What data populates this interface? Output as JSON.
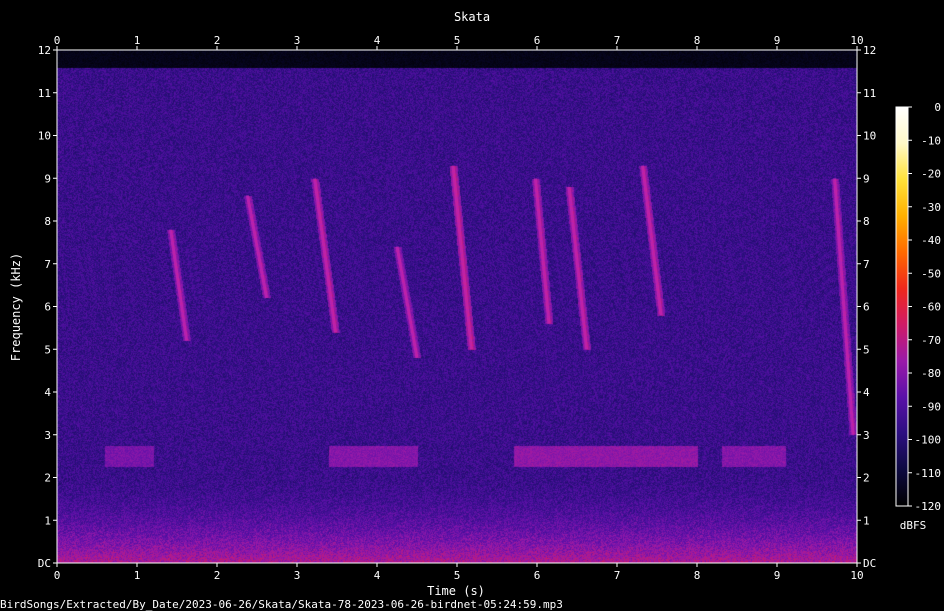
{
  "chart_data": {
    "type": "heatmap",
    "title": "Skata",
    "xlabel": "Time (s)",
    "ylabel": "Frequency (kHz)",
    "xlim": [
      0,
      10
    ],
    "ylim": [
      0,
      12
    ],
    "x_ticks": [
      "0",
      "1",
      "2",
      "3",
      "4",
      "5",
      "6",
      "7",
      "8",
      "9",
      "10"
    ],
    "y_ticks": [
      "DC",
      "1",
      "2",
      "3",
      "4",
      "5",
      "6",
      "7",
      "8",
      "9",
      "10",
      "11",
      "12"
    ],
    "colorbar": {
      "label": "dBFS",
      "range": [
        -120,
        0
      ],
      "ticks": [
        "0",
        "-10",
        "-20",
        "-30",
        "-40",
        "-50",
        "-60",
        "-70",
        "-80",
        "-90",
        "-100",
        "-110",
        "-120"
      ],
      "colors": [
        "#000000",
        "#0d0a40",
        "#2c0f80",
        "#5a10a8",
        "#9a1aa8",
        "#d01b66",
        "#f0281c",
        "#ff6a00",
        "#ffb000",
        "#ffe23a",
        "#fff8c8",
        "#ffffff"
      ]
    },
    "background_level_dbfs": -95,
    "lowband_energy": {
      "freq_khz": [
        0,
        2
      ],
      "level_dbfs": -75
    },
    "band_2_5khz": [
      {
        "t_start": 0.6,
        "t_end": 1.2,
        "level_dbfs": -82
      },
      {
        "t_start": 3.4,
        "t_end": 4.5,
        "level_dbfs": -80
      },
      {
        "t_start": 5.7,
        "t_end": 8.0,
        "level_dbfs": -78
      },
      {
        "t_start": 8.3,
        "t_end": 9.1,
        "level_dbfs": -80
      }
    ],
    "calls": [
      {
        "t_start": 1.42,
        "t_end": 1.62,
        "f_high_khz": 7.8,
        "f_low_khz": 5.2,
        "level_dbfs": -72
      },
      {
        "t_start": 2.38,
        "t_end": 2.62,
        "f_high_khz": 8.6,
        "f_low_khz": 6.2,
        "level_dbfs": -72
      },
      {
        "t_start": 3.22,
        "t_end": 3.48,
        "f_high_khz": 9.0,
        "f_low_khz": 5.4,
        "level_dbfs": -70
      },
      {
        "t_start": 4.25,
        "t_end": 4.5,
        "f_high_khz": 7.4,
        "f_low_khz": 4.8,
        "level_dbfs": -72
      },
      {
        "t_start": 4.95,
        "t_end": 5.18,
        "f_high_khz": 9.3,
        "f_low_khz": 5.0,
        "level_dbfs": -68
      },
      {
        "t_start": 5.98,
        "t_end": 6.15,
        "f_high_khz": 9.0,
        "f_low_khz": 5.6,
        "level_dbfs": -70
      },
      {
        "t_start": 6.4,
        "t_end": 6.62,
        "f_high_khz": 8.8,
        "f_low_khz": 5.0,
        "level_dbfs": -70
      },
      {
        "t_start": 7.32,
        "t_end": 7.55,
        "f_high_khz": 9.3,
        "f_low_khz": 5.8,
        "level_dbfs": -70
      },
      {
        "t_start": 9.72,
        "t_end": 9.95,
        "f_high_khz": 9.0,
        "f_low_khz": 3.0,
        "level_dbfs": -72
      }
    ],
    "grid": false
  },
  "footer": {
    "file_path": "BirdSongs/Extracted/By_Date/2023-06-26/Skata/Skata-78-2023-06-26-birdnet-05:24:59.mp3"
  }
}
